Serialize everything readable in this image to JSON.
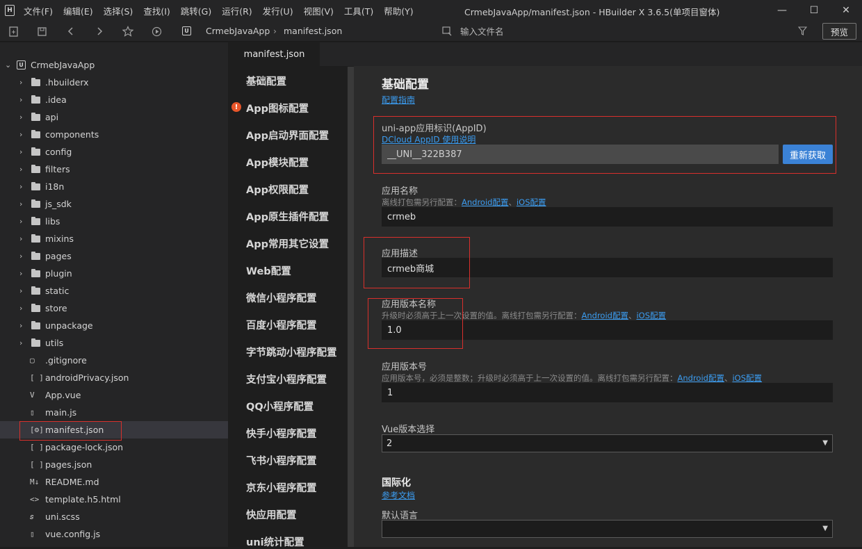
{
  "window": {
    "title": "CrmebJavaApp/manifest.json - HBuilder X 3.6.5(单项目窗体)",
    "logo": "H",
    "menu": [
      "文件(F)",
      "编辑(E)",
      "选择(S)",
      "查找(I)",
      "跳转(G)",
      "运行(R)",
      "发行(U)",
      "视图(V)",
      "工具(T)",
      "帮助(Y)"
    ],
    "controls": {
      "minimize": "—",
      "maximize": "☐",
      "close": "✕"
    }
  },
  "toolbar": {
    "icons": [
      "new-file-icon",
      "save-icon",
      "back-icon",
      "forward-icon",
      "star-icon",
      "run-icon"
    ],
    "breadcrumb": {
      "badge": "U",
      "project": "CrmebJavaApp",
      "separator": "›",
      "file": "manifest.json"
    },
    "search_placeholder": "输入文件名",
    "preview_label": "预览"
  },
  "explorer": {
    "root": {
      "badge": "U",
      "name": "CrmebJavaApp"
    },
    "folders": [
      ".hbuilderx",
      ".idea",
      "api",
      "components",
      "config",
      "filters",
      "i18n",
      "js_sdk",
      "libs",
      "mixins",
      "pages",
      "plugin",
      "static",
      "store",
      "unpackage",
      "utils"
    ],
    "files": [
      {
        "icon": "▢",
        "name": ".gitignore"
      },
      {
        "icon": "[ ]",
        "name": "androidPrivacy.json"
      },
      {
        "icon": "V",
        "name": "App.vue"
      },
      {
        "icon": "▯",
        "name": "main.js"
      },
      {
        "icon": "[⚙]",
        "name": "manifest.json"
      },
      {
        "icon": "[ ]",
        "name": "package-lock.json"
      },
      {
        "icon": "[ ]",
        "name": "pages.json"
      },
      {
        "icon": "M↓",
        "name": "README.md"
      },
      {
        "icon": "<>",
        "name": "template.h5.html"
      },
      {
        "icon": "𝑠",
        "name": "uni.scss"
      },
      {
        "icon": "▯",
        "name": "vue.config.js"
      }
    ],
    "selected": "manifest.json"
  },
  "editor": {
    "tab_label": "manifest.json",
    "nav": [
      "基础配置",
      "App图标配置",
      "App启动界面配置",
      "App模块配置",
      "App权限配置",
      "App原生插件配置",
      "App常用其它设置",
      "Web配置",
      "微信小程序配置",
      "百度小程序配置",
      "字节跳动小程序配置",
      "支付宝小程序配置",
      "QQ小程序配置",
      "快手小程序配置",
      "飞书小程序配置",
      "京东小程序配置",
      "快应用配置",
      "uni统计配置"
    ],
    "warning_icon": "!"
  },
  "form": {
    "title": "基础配置",
    "guide_link": "配置指南",
    "appid": {
      "label": "uni-app应用标识(AppID)",
      "help_link": "DCloud AppID 使用说明",
      "value": "__UNI__322B387",
      "button": "重新获取"
    },
    "app_name": {
      "label": "应用名称",
      "desc": "离线打包需另行配置：",
      "link_android": "Android配置",
      "sep": "、",
      "link_ios": "iOS配置",
      "value": "crmeb"
    },
    "app_desc": {
      "label": "应用描述",
      "value": "crmeb商城"
    },
    "version_name": {
      "label": "应用版本名称",
      "desc": "升级时必须高于上一次设置的值。离线打包需另行配置：",
      "link_android": "Android配置",
      "sep": "、",
      "link_ios": "iOS配置",
      "value": "1.0"
    },
    "version_code": {
      "label": "应用版本号",
      "desc": "应用版本号，必须是整数；升级时必须高于上一次设置的值。离线打包需另行配置：",
      "link_android": "Android配置",
      "sep": "、",
      "link_ios": "iOS配置",
      "value": "1"
    },
    "vue_version": {
      "label": "Vue版本选择",
      "value": "2",
      "arrow": "▼"
    },
    "i18n": {
      "title": "国际化",
      "link": "参考文档",
      "default_lang_label": "默认语言",
      "value": "",
      "arrow": "▼"
    }
  },
  "colors": {
    "highlight": "#d9302c",
    "accent": "#3b82d6",
    "link": "#3b9cf0",
    "warning": "#e8562a"
  }
}
